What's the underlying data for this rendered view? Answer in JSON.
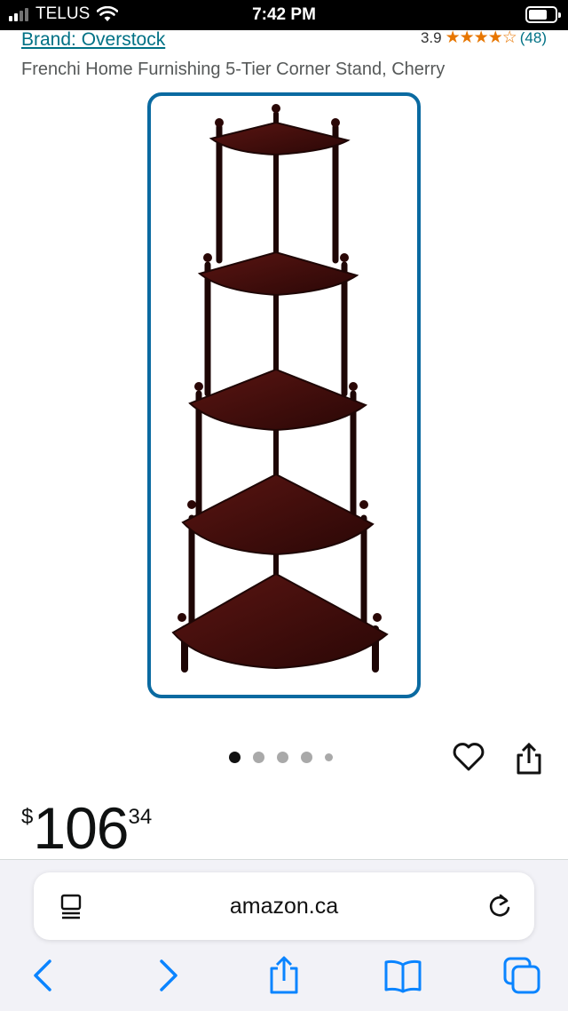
{
  "status_bar": {
    "carrier": "TELUS",
    "time": "7:42 PM"
  },
  "brand": {
    "label": "Brand: Overstock"
  },
  "rating": {
    "value": "3.9",
    "stars": "★★★★☆",
    "count": "(48)"
  },
  "product": {
    "title": "Frenchi Home Furnishing 5-Tier Corner Stand, Cherry"
  },
  "gallery": {
    "total_images": 5,
    "active_index": 0
  },
  "price": {
    "symbol": "$",
    "whole": "106",
    "fraction": "34"
  },
  "browser": {
    "url": "amazon.ca"
  },
  "colors": {
    "link": "#007185",
    "star": "#e77600",
    "accent": "#0a6aa1",
    "ios_blue": "#0a84ff",
    "wood": "#3d0d0c"
  },
  "icons": [
    "signal-icon",
    "wifi-icon",
    "battery-icon",
    "heart-icon",
    "share-icon",
    "reader-icon",
    "reload-icon",
    "back-icon",
    "forward-icon",
    "share-sheet-icon",
    "bookmarks-icon",
    "tabs-icon"
  ]
}
